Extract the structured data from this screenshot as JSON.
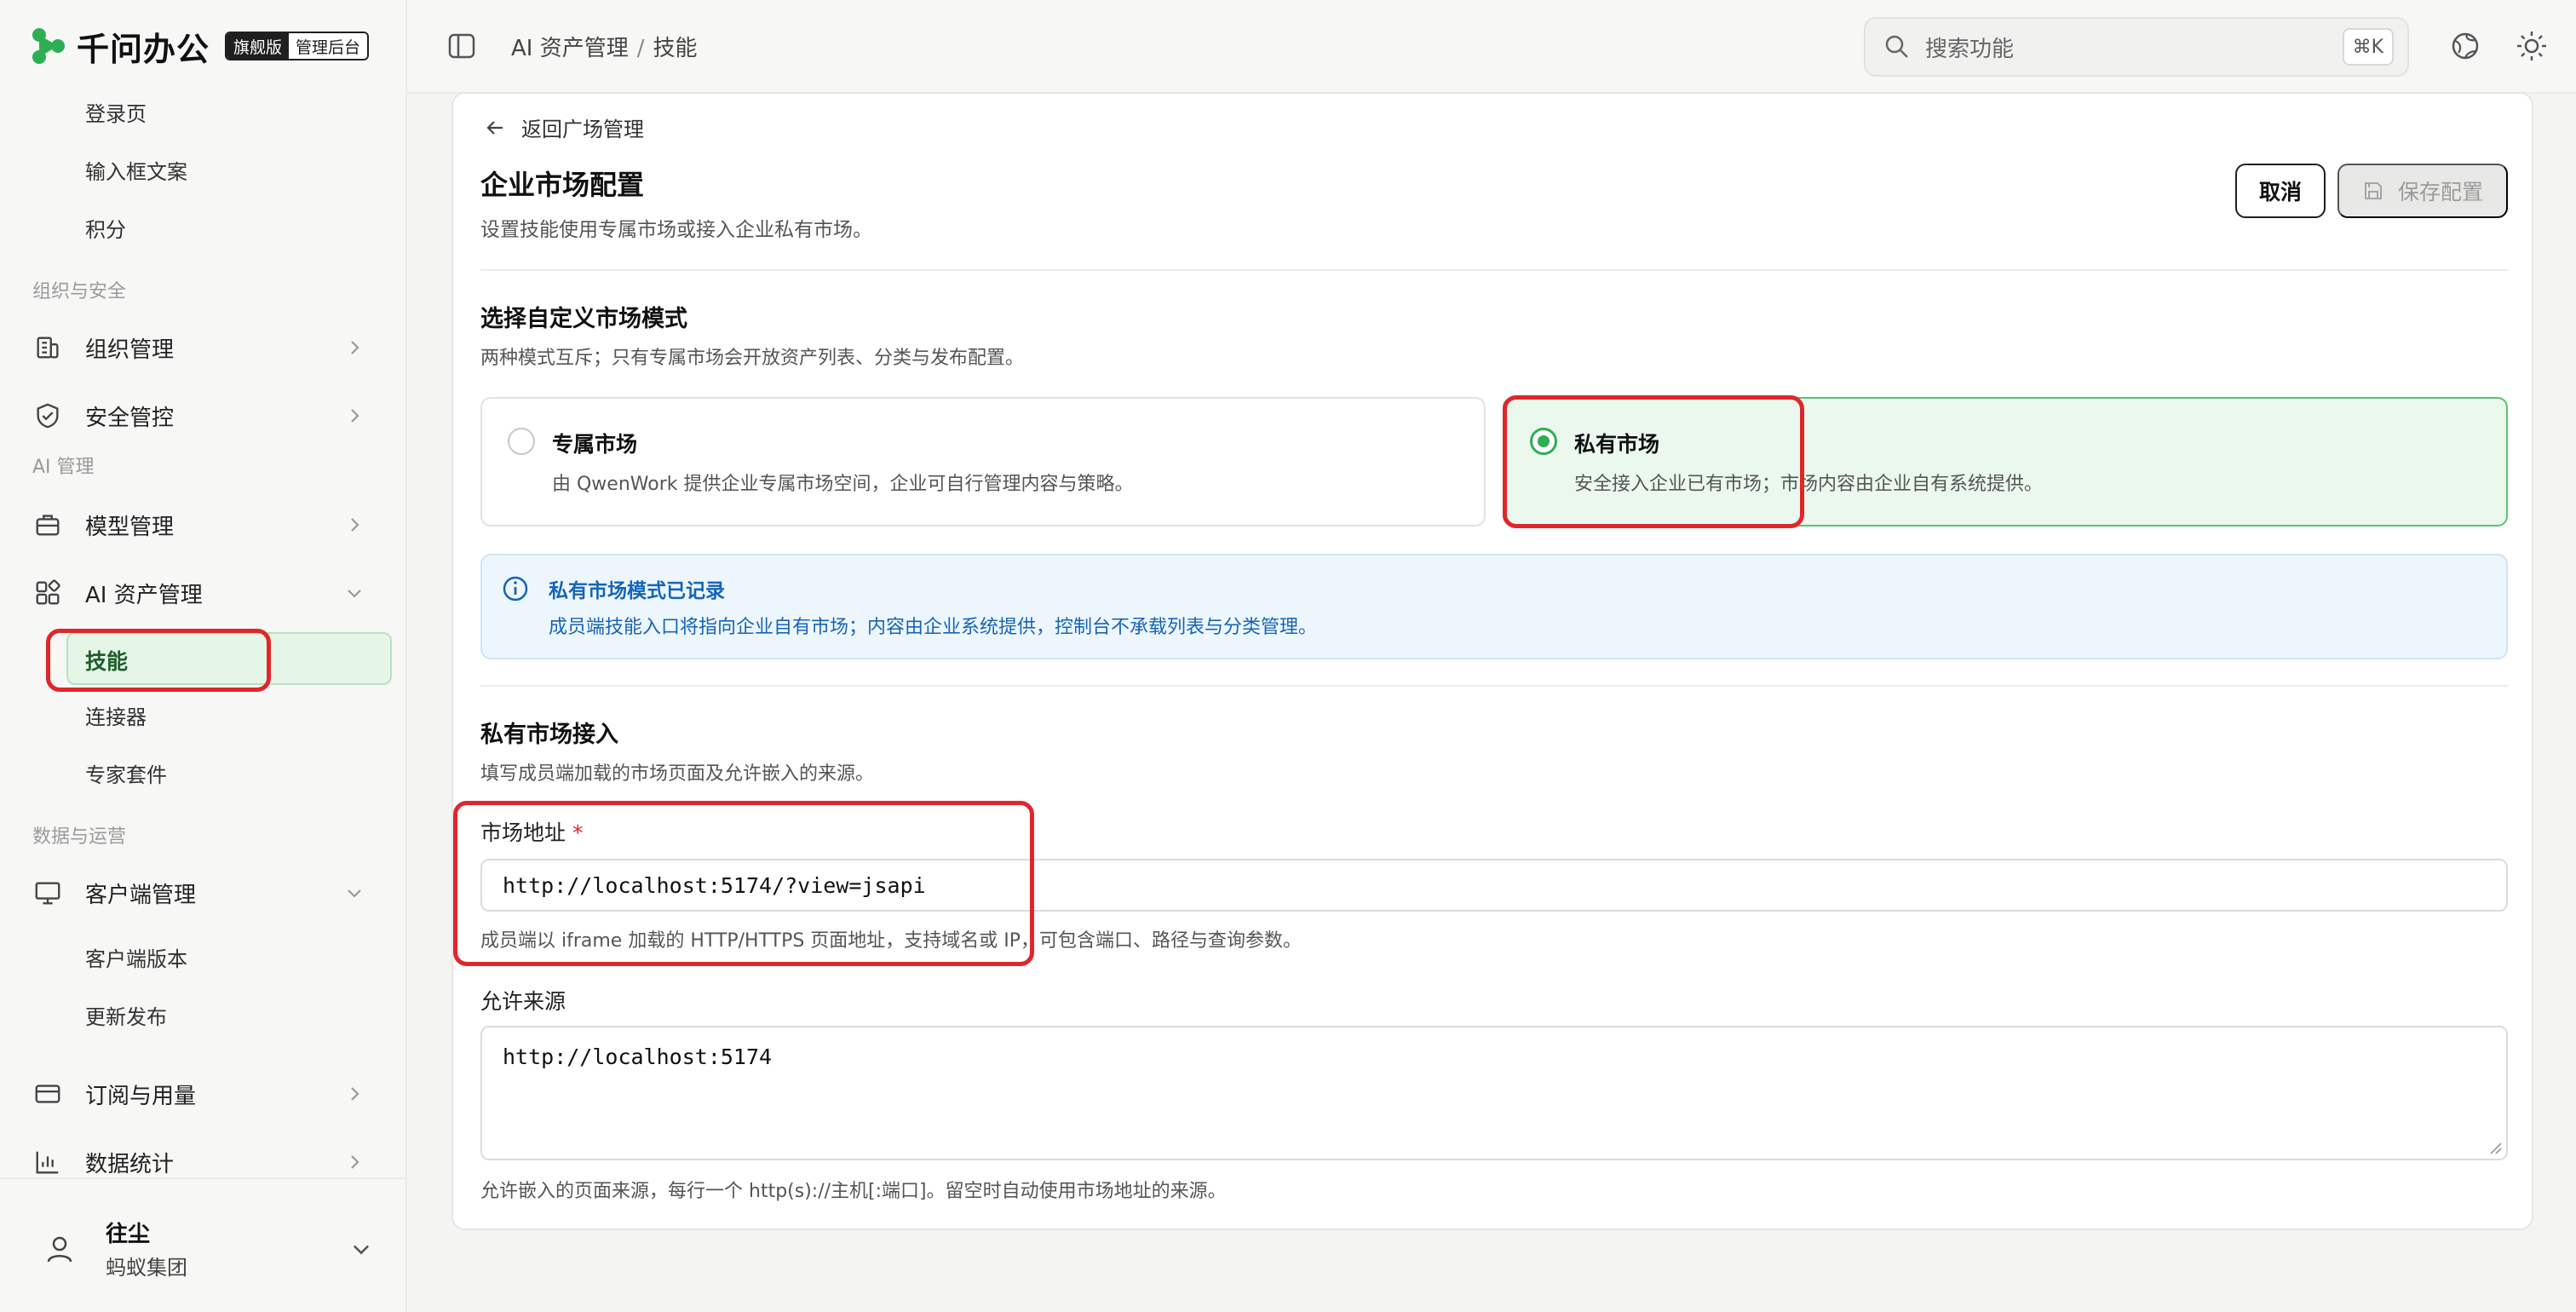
{
  "brand": {
    "name": "千问办公",
    "edition": "旗舰版",
    "console": "管理后台",
    "accent": "#2dae52"
  },
  "sidebar": {
    "top_items": [
      "登录页",
      "输入框文案",
      "积分"
    ],
    "groups": {
      "org_security": "组织与安全",
      "ai": "AI 管理",
      "data_ops": "数据与运营"
    },
    "items": {
      "org": "组织管理",
      "security": "安全管控",
      "model": "模型管理",
      "ai_assets": "AI 资产管理",
      "client": "客户端管理",
      "subscription": "订阅与用量",
      "stats": "数据统计"
    },
    "ai_assets_children": [
      "技能",
      "连接器",
      "专家套件"
    ],
    "client_children": [
      "客户端版本",
      "更新发布"
    ],
    "user": {
      "name": "往尘",
      "org": "蚂蚁集团"
    }
  },
  "header": {
    "breadcrumb": [
      "AI 资产管理",
      "技能"
    ],
    "breadcrumb_sep": "/",
    "search_placeholder": "搜索功能",
    "search_shortcut": "⌘K"
  },
  "page": {
    "back_label": "返回广场管理",
    "title": "企业市场配置",
    "description": "设置技能使用专属市场或接入企业私有市场。",
    "cancel_label": "取消",
    "save_label": "保存配置"
  },
  "mode_section": {
    "title": "选择自定义市场模式",
    "description": "两种模式互斥；只有专属市场会开放资产列表、分类与发布配置。",
    "options": [
      {
        "title": "专属市场",
        "description": "由 QwenWork 提供企业专属市场空间，企业可自行管理内容与策略。",
        "selected": false
      },
      {
        "title": "私有市场",
        "description": "安全接入企业已有市场；市场内容由企业自有系统提供。",
        "selected": true
      }
    ]
  },
  "notice": {
    "title": "私有市场模式已记录",
    "description": "成员端技能入口将指向企业自有市场；内容由企业系统提供，控制台不承载列表与分类管理。",
    "color": "#1565b8"
  },
  "private_section": {
    "title": "私有市场接入",
    "description": "填写成员端加载的市场页面及允许嵌入的来源。",
    "url_label": "市场地址",
    "required_mark": "*",
    "url_value": "http://localhost:5174/?view=jsapi",
    "url_help": "成员端以 iframe 加载的 HTTP/HTTPS 页面地址，支持域名或 IP，可包含端口、路径与查询参数。",
    "origins_label": "允许来源",
    "origins_value": "http://localhost:5174",
    "origins_help": "允许嵌入的页面来源，每行一个 http(s)://主机[:端口]。留空时自动使用市场地址的来源。"
  }
}
